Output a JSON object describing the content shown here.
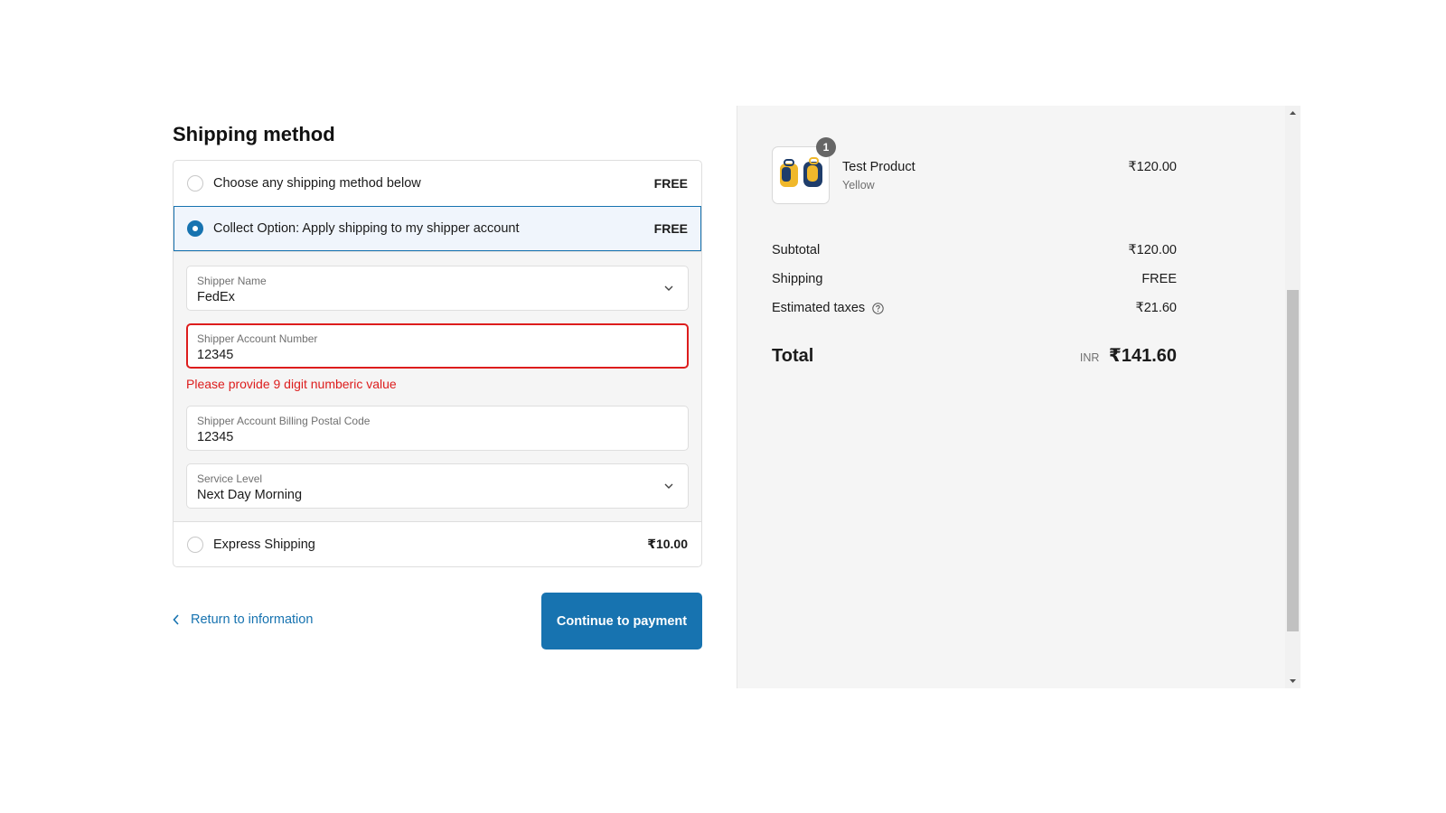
{
  "shipping": {
    "title": "Shipping method",
    "options": [
      {
        "label": "Choose any shipping method below",
        "price": "FREE",
        "selected": false
      },
      {
        "label": "Collect Option: Apply shipping to my shipper account",
        "price": "FREE",
        "selected": true
      },
      {
        "label": "Express Shipping",
        "price": "₹10.00",
        "selected": false
      }
    ],
    "collect_form": {
      "shipper_name": {
        "label": "Shipper Name",
        "value": "FedEx"
      },
      "account_number": {
        "label": "Shipper Account Number",
        "value": "12345",
        "error": "Please provide 9 digit numberic value"
      },
      "billing_postal": {
        "label": "Shipper Account Billing Postal Code",
        "value": "12345"
      },
      "service_level": {
        "label": "Service Level",
        "value": "Next Day Morning"
      }
    }
  },
  "actions": {
    "return_label": "Return to information",
    "continue_label": "Continue to payment",
    "accent_color": "#1773b0"
  },
  "summary": {
    "product": {
      "name": "Test Product",
      "variant": "Yellow",
      "price": "₹120.00",
      "quantity": "1"
    },
    "subtotal": {
      "label": "Subtotal",
      "value": "₹120.00"
    },
    "shipping": {
      "label": "Shipping",
      "value": "FREE"
    },
    "taxes": {
      "label": "Estimated taxes",
      "value": "₹21.60"
    },
    "total": {
      "label": "Total",
      "currency": "INR",
      "value": "₹141.60"
    }
  },
  "colors": {
    "error": "#dd1d1d",
    "panel_bg": "#f5f5f5"
  }
}
